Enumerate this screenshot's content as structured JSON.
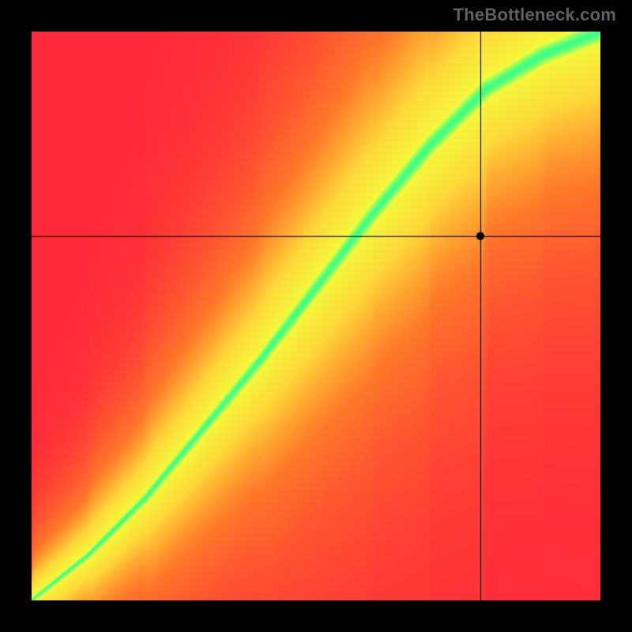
{
  "watermark": "TheBottleneck.com",
  "chart_data": {
    "type": "heatmap",
    "title": "",
    "xlabel": "",
    "ylabel": "",
    "xlim": [
      0,
      100
    ],
    "ylim": [
      0,
      100
    ],
    "marker": {
      "x": 79,
      "y": 64
    },
    "crosshair": {
      "x": 79,
      "y": 64
    },
    "optimal_curve": [
      {
        "x": 0,
        "y": 0
      },
      {
        "x": 10,
        "y": 8
      },
      {
        "x": 20,
        "y": 18
      },
      {
        "x": 30,
        "y": 30
      },
      {
        "x": 40,
        "y": 42
      },
      {
        "x": 50,
        "y": 55
      },
      {
        "x": 60,
        "y": 68
      },
      {
        "x": 70,
        "y": 80
      },
      {
        "x": 80,
        "y": 90
      },
      {
        "x": 90,
        "y": 96
      },
      {
        "x": 100,
        "y": 100
      }
    ],
    "color_stops": [
      {
        "t": 0.0,
        "color": "#ff2a3a"
      },
      {
        "t": 0.35,
        "color": "#ff7a2a"
      },
      {
        "t": 0.6,
        "color": "#ffd83a"
      },
      {
        "t": 0.82,
        "color": "#f3ff3a"
      },
      {
        "t": 0.94,
        "color": "#7aff6a"
      },
      {
        "t": 1.0,
        "color": "#1eff9a"
      }
    ]
  }
}
